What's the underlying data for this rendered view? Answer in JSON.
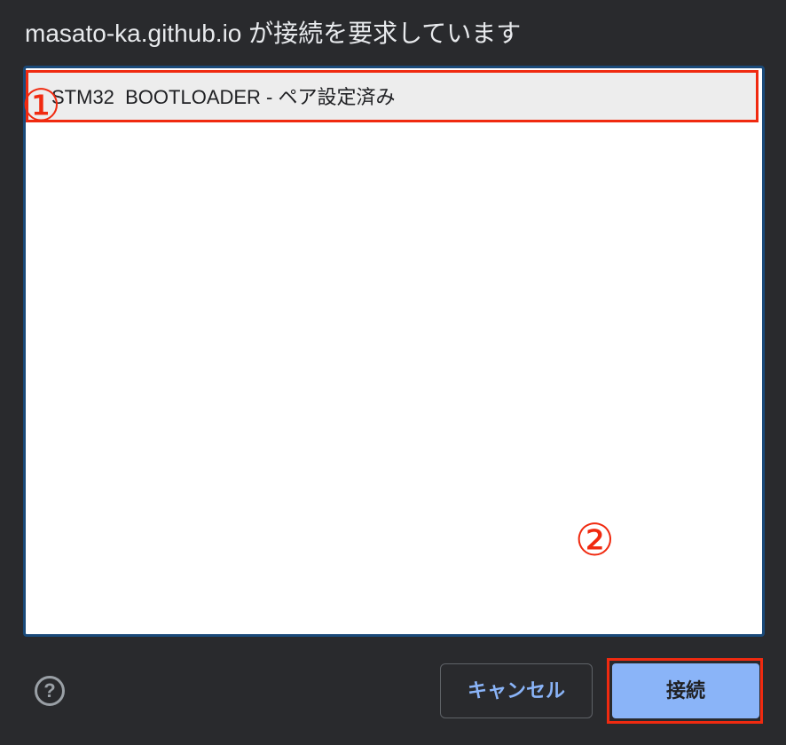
{
  "dialog": {
    "title": "masato-ka.github.io が接続を要求しています"
  },
  "device_list": {
    "items": [
      {
        "label": "STM32  BOOTLOADER - ペア設定済み"
      }
    ]
  },
  "annotations": {
    "marker_1": "①",
    "marker_2": "②",
    "highlight_color": "#f02a10"
  },
  "footer": {
    "help_icon": "?",
    "cancel_label": "キャンセル",
    "connect_label": "接続"
  },
  "colors": {
    "background": "#292a2d",
    "accent": "#8ab4f8",
    "annotation": "#f02a10"
  }
}
